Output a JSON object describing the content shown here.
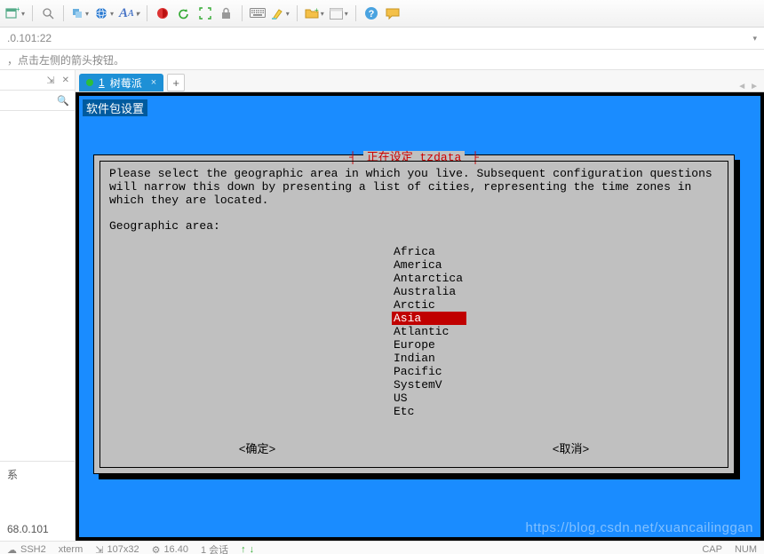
{
  "addr": {
    "text": ".0.101:22"
  },
  "hint": {
    "text": "，点击左侧的箭头按钮。"
  },
  "side": {
    "pin_glyph": "⇲",
    "close_glyph": "✕",
    "search_glyph": "🔍",
    "sessions_label": "系",
    "ip_label": "68.0.101"
  },
  "tab": {
    "index": "1",
    "title": "树莓派",
    "close_glyph": "×",
    "add_glyph": "+",
    "nav_prev": "◄",
    "nav_next": "►"
  },
  "terminal": {
    "package_title": "软件包设置",
    "dialog_title": "正在设定 tzdata",
    "instruction": "Please select the geographic area in which you live. Subsequent configuration questions will narrow this down by presenting a list of cities, representing the time zones in which they are located.",
    "field_label": "Geographic area:",
    "options": [
      "Africa",
      "America",
      "Antarctica",
      "Australia",
      "Arctic",
      "Asia",
      "Atlantic",
      "Europe",
      "Indian",
      "Pacific",
      "SystemV",
      "US",
      "Etc"
    ],
    "selected": "Asia",
    "ok_label": "<确定>",
    "cancel_label": "<取消>",
    "watermark": "https://blog.csdn.net/xuancailinggan"
  },
  "status": {
    "proto": "SSH2",
    "term": "xterm",
    "size": "107x32",
    "fx": "16.40",
    "session": "1 会话",
    "net_up": "↑",
    "net_dn": "↓",
    "caps": "CAP",
    "num": "NUM"
  }
}
